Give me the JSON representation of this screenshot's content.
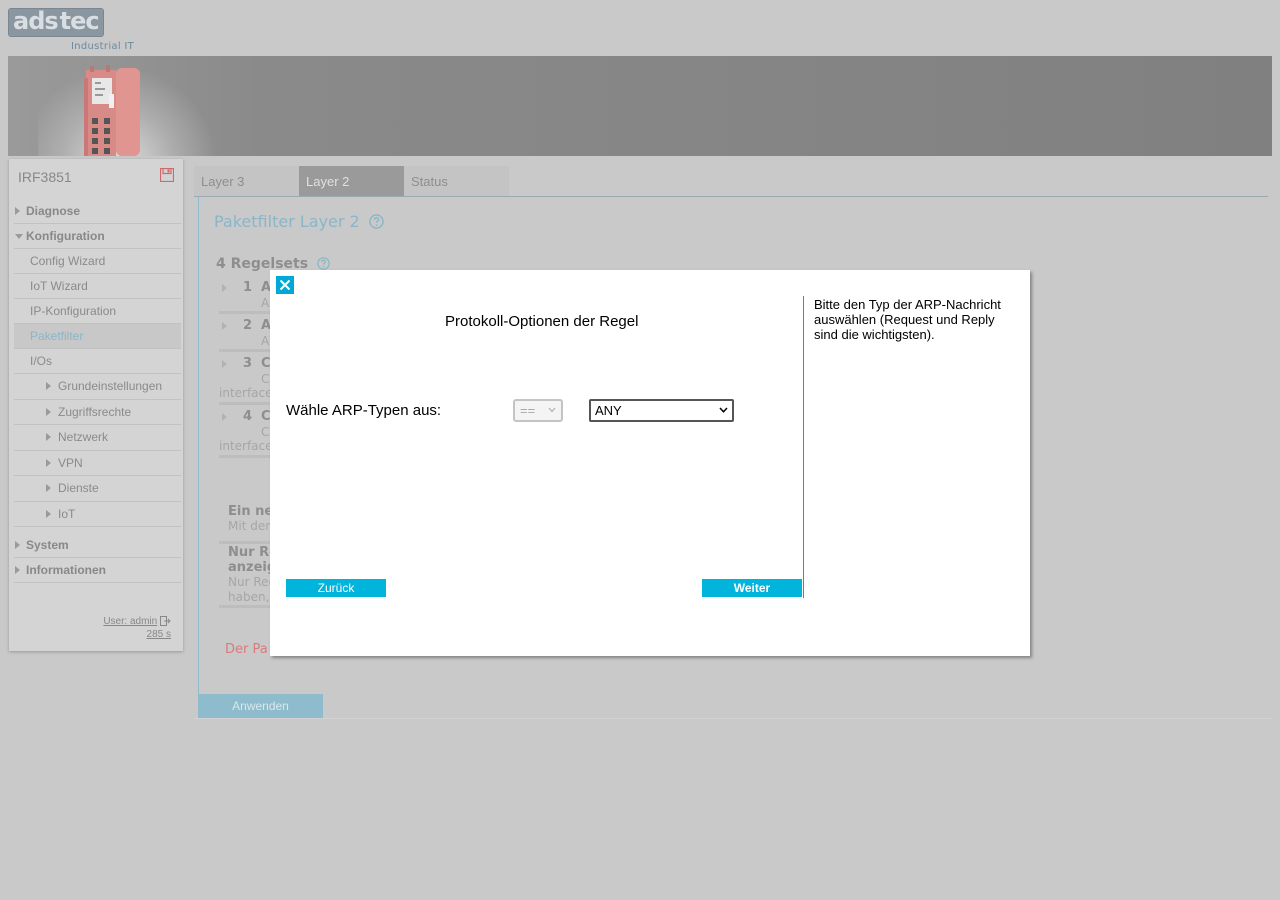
{
  "header": {
    "logo_left": "ads",
    "logo_right": "tec",
    "logo_subtitle": "Industrial IT"
  },
  "sidebar": {
    "device_name": "IRF3851",
    "items": [
      {
        "label": "Diagnose",
        "level": 0,
        "expanded": false
      },
      {
        "label": "Konfiguration",
        "level": 0,
        "expanded": true
      },
      {
        "label": "Config Wizard",
        "level": 1
      },
      {
        "label": "IoT Wizard",
        "level": 1
      },
      {
        "label": "IP-Konfiguration",
        "level": 1
      },
      {
        "label": "Paketfilter",
        "level": 1,
        "active": true
      },
      {
        "label": "I/Os",
        "level": 1
      },
      {
        "label": "Grundeinstellungen",
        "level": 2
      },
      {
        "label": "Zugriffsrechte",
        "level": 2
      },
      {
        "label": "Netzwerk",
        "level": 2
      },
      {
        "label": "VPN",
        "level": 2
      },
      {
        "label": "Dienste",
        "level": 2
      },
      {
        "label": "IoT",
        "level": 2
      },
      {
        "label": "System",
        "level": 0,
        "expanded": false
      },
      {
        "label": "Informationen",
        "level": 0,
        "expanded": false
      }
    ],
    "user_label": "User: admin",
    "session_time": "285 s"
  },
  "tabs": [
    {
      "label": "Layer 3",
      "active": false
    },
    {
      "label": "Layer 2",
      "active": true
    },
    {
      "label": "Status",
      "active": false
    }
  ],
  "main": {
    "title": "Paketfilter Layer 2",
    "rulesets_title": "4 Regelsets",
    "rules": [
      {
        "num": "1",
        "name": "A",
        "desc": "A",
        "desc2": ""
      },
      {
        "num": "2",
        "name": "A",
        "desc": "A",
        "desc2": ""
      },
      {
        "num": "3",
        "name": "C",
        "desc": "C",
        "desc2": "interface"
      },
      {
        "num": "4",
        "name": "C",
        "desc": "C",
        "desc2": "interface"
      }
    ],
    "new_box": {
      "heading": "Ein ne",
      "text": "Mit den"
    },
    "only_box": {
      "heading_1": "Nur Re",
      "heading_2": "anzeig",
      "text_1": "Nur Rec",
      "text_2": "haben,"
    },
    "warning": "Der Pa",
    "apply_label": "Anwenden"
  },
  "modal": {
    "heading": "Protokoll-Optionen der Regel",
    "field_label": "Wähle ARP-Typen aus:",
    "operator_value": "==",
    "arp_type_value": "ANY",
    "back_label": "Zurück",
    "next_label": "Weiter",
    "hint": "Bitte den Typ der ARP-Nachricht auswählen (Request und Reply sind die wichtigsten)."
  },
  "colors": {
    "accent": "#00b4dc",
    "accent_muted": "#8fbccc",
    "overlay_bg": "#c9c9c9",
    "warning": "#d87b7b"
  }
}
